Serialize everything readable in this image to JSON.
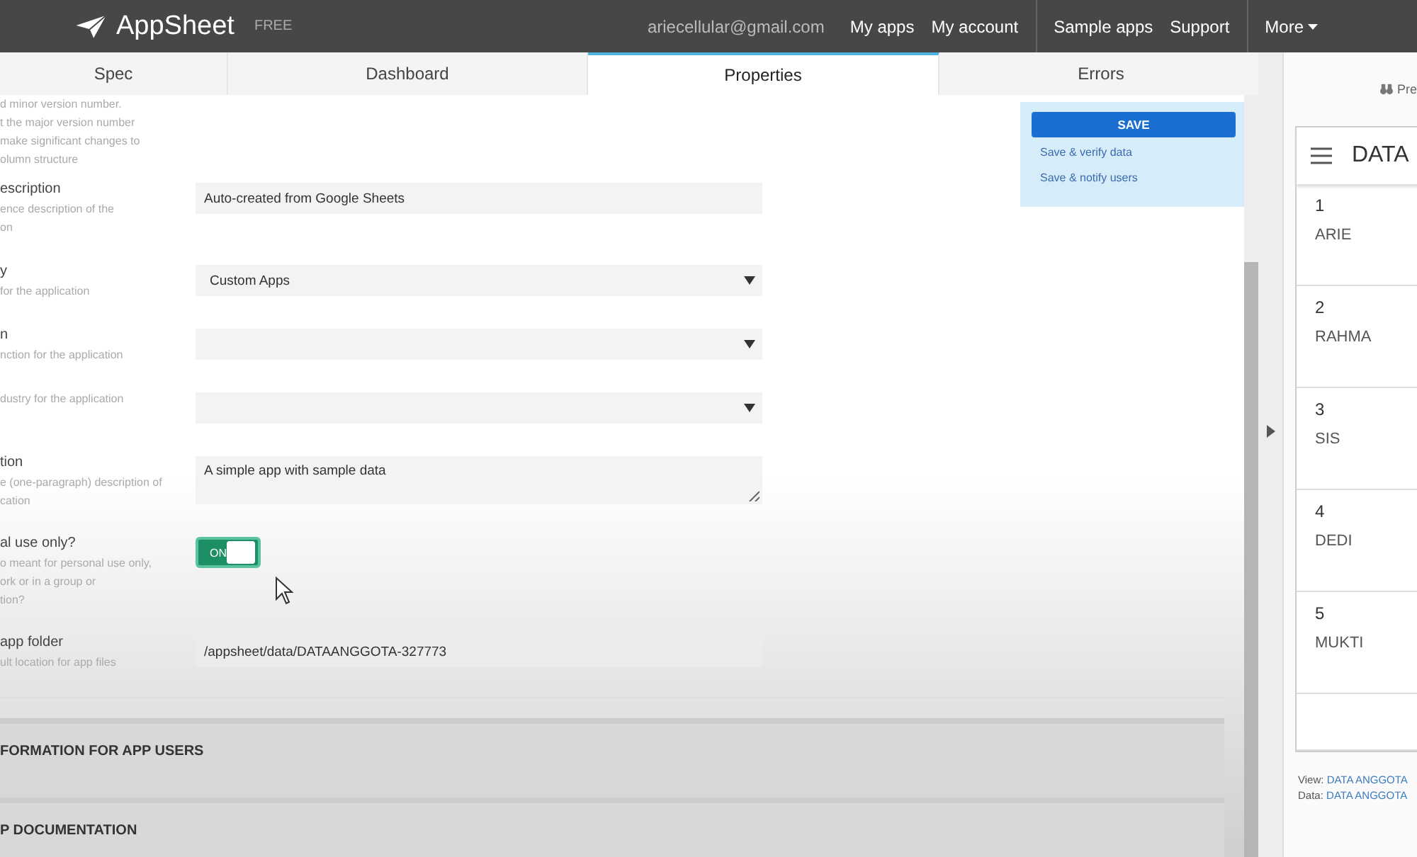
{
  "topbar": {
    "brand": "AppSheet",
    "plan": "FREE",
    "email": "ariecellular@gmail.com",
    "links": [
      "My apps",
      "My account",
      "Sample apps",
      "Support"
    ],
    "more": "More"
  },
  "tabs": [
    {
      "label": "Spec",
      "selected": false
    },
    {
      "label": "Dashboard",
      "selected": false
    },
    {
      "label": "Properties",
      "selected": true
    },
    {
      "label": "Errors",
      "selected": false
    }
  ],
  "properties": [
    {
      "kind": "note",
      "description": [
        "d minor version number.",
        "t the major version number",
        "make significant changes to",
        "olumn structure"
      ]
    },
    {
      "kind": "text",
      "title": "escription",
      "description": [
        "ence description of the",
        "on"
      ],
      "value": "Auto-created from Google Sheets"
    },
    {
      "kind": "select",
      "title": "y",
      "description": [
        "for the application"
      ],
      "value": "Custom Apps"
    },
    {
      "kind": "select",
      "title": "n",
      "description": [
        "nction for the application"
      ]
    },
    {
      "kind": "select",
      "description": [
        "dustry for the application"
      ]
    },
    {
      "kind": "textarea",
      "title": "tion",
      "description": [
        "e (one-paragraph) description of",
        "cation"
      ],
      "value": "A simple app with sample data"
    },
    {
      "kind": "toggle",
      "title": "al use only?",
      "description": [
        "o meant for personal use only,",
        "ork or in a group or",
        "tion?"
      ],
      "on": true,
      "toggle_label": "ON"
    },
    {
      "kind": "readonly",
      "title": "app folder",
      "description": [
        "ult location for app files"
      ],
      "value": "/appsheet/data/DATAANGGOTA-327773"
    }
  ],
  "sections": [
    "FORMATION FOR APP USERS",
    "P DOCUMENTATION"
  ],
  "save_panel": {
    "button": "SAVE",
    "links": [
      "Save & verify data",
      "Save & notify users"
    ]
  },
  "preview": {
    "label": "Pre",
    "header": "DATA",
    "rows": [
      {
        "number": "1",
        "name": "ARIE"
      },
      {
        "number": "2",
        "name": "RAHMA"
      },
      {
        "number": "3",
        "name": "SIS"
      },
      {
        "number": "4",
        "name": "DEDI"
      },
      {
        "number": "5",
        "name": "MUKTI"
      }
    ],
    "footer": [
      {
        "label": "View:",
        "value": "DATA ANGGOTA"
      },
      {
        "label": "Data:",
        "value": "DATA ANGGOTA"
      }
    ]
  }
}
